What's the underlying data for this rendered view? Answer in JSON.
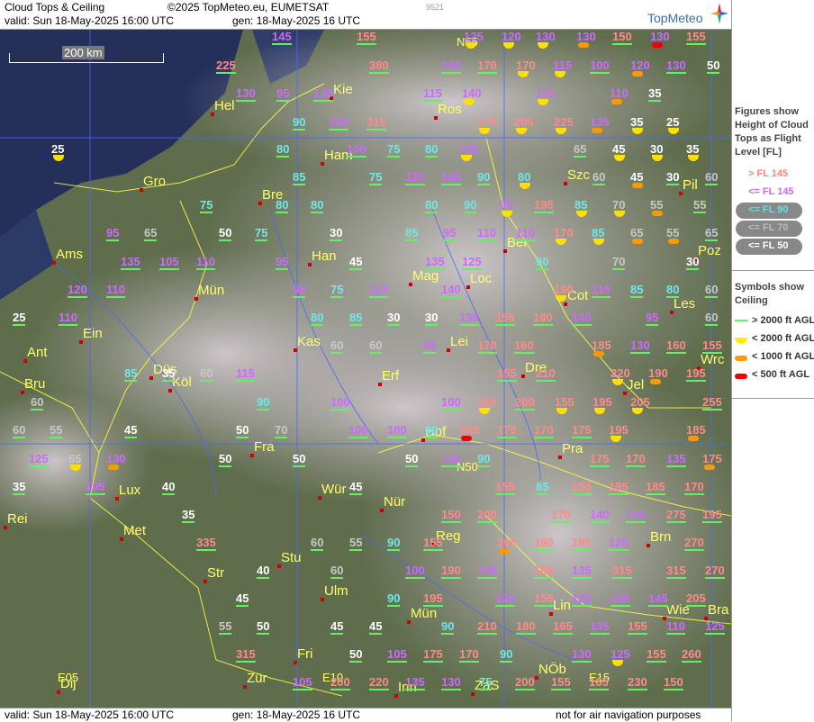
{
  "header": {
    "title": "Cloud Tops & Ceiling",
    "copyright": "©2025 TopMeteo.eu, EUMETSAT",
    "id": "9521",
    "valid": "valid:  Sun  18-May-2025  16:00 UTC",
    "generated": "gen: 18-May-2025 16 UTC",
    "logo": "TopMeteo"
  },
  "footer": {
    "valid": "valid:  Sun  18-May-2025  16:00 UTC",
    "generated": "gen: 18-May-2025 16 UTC",
    "note": "not for air navigation purposes"
  },
  "scale": "200 km",
  "legend": {
    "figures_title": "Figures show Height of Cloud Tops as Flight Level  [FL]",
    "fl_items": [
      {
        "label": "> FL 145",
        "color": "#ff8080"
      },
      {
        "label": "<= FL 145",
        "color": "#cc66ff"
      },
      {
        "label": "<= FL 90",
        "color": "#66e0e0"
      },
      {
        "label": "<= FL 70",
        "color": "#bbbbbb"
      },
      {
        "label": "<= FL 50",
        "color": "#ffffff"
      }
    ],
    "symbols_title": "Symbols show Ceiling",
    "ceil_items": [
      {
        "label": "> 2000 ft AGL",
        "color": "#66ee66"
      },
      {
        "label": "< 2000 ft AGL",
        "color": "#ffee00"
      },
      {
        "label": "< 1000 ft AGL",
        "color": "#ff9900"
      },
      {
        "label": "< 500 ft AGL",
        "color": "#ee0000"
      }
    ]
  },
  "cities": [
    "Hel",
    "Kie",
    "Ham",
    "Gro",
    "Bre",
    "Ams",
    "Han",
    "Ber",
    "Mag",
    "Loc",
    "Szc",
    "Pil",
    "Poz",
    "Cot",
    "Les",
    "Ein",
    "Mün",
    "Kas",
    "Lei",
    "Dre",
    "Wrc",
    "Ant",
    "Düs",
    "Köl",
    "Bru",
    "Erf",
    "Jel",
    "Hof",
    "Pra",
    "Fra",
    "Lux",
    "Wür",
    "Nür",
    "Reg",
    "Brn",
    "Met",
    "Stu",
    "Str",
    "Ulm",
    "Mün",
    "Lin",
    "Wie",
    "Bra",
    "Fri",
    "Zür",
    "Inn",
    "ZaS",
    "NÖb",
    "Rei",
    "Dij",
    "Ros"
  ],
  "labels": [
    "N55",
    "N50",
    "E10",
    "E15",
    "E05"
  ],
  "values": [
    [
      "145",
      "N"
    ],
    [
      "155",
      "N"
    ],
    [
      "130",
      "A"
    ],
    [
      "150",
      "N"
    ],
    [
      "130",
      "R"
    ],
    [
      "155",
      "N"
    ],
    [
      "120",
      "Y"
    ],
    [
      "130",
      "Y"
    ],
    [
      "125",
      "Y"
    ],
    [
      "225",
      "N"
    ],
    [
      "380",
      "N"
    ],
    [
      "140",
      "N"
    ],
    [
      "170",
      "N"
    ],
    [
      "170",
      "Y"
    ],
    [
      "115",
      "Y"
    ],
    [
      "100",
      "N"
    ],
    [
      "120",
      "A"
    ],
    [
      "130",
      "N"
    ],
    [
      "50",
      "N"
    ],
    [
      "130",
      "N"
    ],
    [
      "95",
      "N"
    ],
    [
      "130",
      "N"
    ],
    [
      "115",
      "N"
    ],
    [
      "140",
      "Y"
    ],
    [
      "115",
      "Y"
    ],
    [
      "110",
      "A"
    ],
    [
      "35",
      "N"
    ],
    [
      "90",
      "N"
    ],
    [
      "100",
      "N"
    ],
    [
      "315",
      "N"
    ],
    [
      "175",
      "Y"
    ],
    [
      "205",
      "Y"
    ],
    [
      "225",
      "Y"
    ],
    [
      "135",
      "A"
    ],
    [
      "35",
      "Y"
    ],
    [
      "25",
      "Y"
    ],
    [
      "25",
      "Y"
    ],
    [
      "80",
      "N"
    ],
    [
      "100",
      "N"
    ],
    [
      "75",
      "N"
    ],
    [
      "80",
      "N"
    ],
    [
      "130",
      "Y"
    ],
    [
      "65",
      "N"
    ],
    [
      "45",
      "Y"
    ],
    [
      "30",
      "Y"
    ],
    [
      "35",
      "Y"
    ],
    [
      "85",
      "N"
    ],
    [
      "75",
      "N"
    ],
    [
      "120",
      "N"
    ],
    [
      "145",
      "N"
    ],
    [
      "90",
      "N"
    ],
    [
      "80",
      "Y"
    ],
    [
      "60",
      "N"
    ],
    [
      "45",
      "A"
    ],
    [
      "30",
      "N"
    ],
    [
      "60",
      "N"
    ],
    [
      "75",
      "N"
    ],
    [
      "80",
      "N"
    ],
    [
      "80",
      "N"
    ],
    [
      "80",
      "N"
    ],
    [
      "90",
      "N"
    ],
    [
      "95",
      "Y"
    ],
    [
      "195",
      "N"
    ],
    [
      "85",
      "Y"
    ],
    [
      "70",
      "Y"
    ],
    [
      "55",
      "A"
    ],
    [
      "55",
      "N"
    ],
    [
      "95",
      "N"
    ],
    [
      "65",
      "N"
    ],
    [
      "50",
      "N"
    ],
    [
      "75",
      "N"
    ],
    [
      "30",
      "N"
    ],
    [
      "85",
      "N"
    ],
    [
      "95",
      "N"
    ],
    [
      "110",
      "N"
    ],
    [
      "110",
      "N"
    ],
    [
      "170",
      "Y"
    ],
    [
      "85",
      "Y"
    ],
    [
      "65",
      "A"
    ],
    [
      "55",
      "A"
    ],
    [
      "65",
      "N"
    ],
    [
      "135",
      "N"
    ],
    [
      "105",
      "N"
    ],
    [
      "110",
      "N"
    ],
    [
      "95",
      "N"
    ],
    [
      "45",
      "N"
    ],
    [
      "135",
      "N"
    ],
    [
      "125",
      "N"
    ],
    [
      "90",
      "N"
    ],
    [
      "70",
      "N"
    ],
    [
      "30",
      "N"
    ],
    [
      "120",
      "N"
    ],
    [
      "110",
      "N"
    ],
    [
      "75",
      "N"
    ],
    [
      "115",
      "N"
    ],
    [
      "95",
      "N"
    ],
    [
      "140",
      "N"
    ],
    [
      "190",
      "Y"
    ],
    [
      "115",
      "N"
    ],
    [
      "85",
      "N"
    ],
    [
      "80",
      "N"
    ],
    [
      "60",
      "N"
    ],
    [
      "25",
      "N"
    ],
    [
      "110",
      "N"
    ],
    [
      "80",
      "N"
    ],
    [
      "85",
      "N"
    ],
    [
      "30",
      "N"
    ],
    [
      "30",
      "N"
    ],
    [
      "135",
      "N"
    ],
    [
      "155",
      "N"
    ],
    [
      "190",
      "N"
    ],
    [
      "140",
      "N"
    ],
    [
      "95",
      "N"
    ],
    [
      "60",
      "N"
    ],
    [
      "60",
      "N"
    ],
    [
      "60",
      "N"
    ],
    [
      "95",
      "N"
    ],
    [
      "170",
      "N"
    ],
    [
      "160",
      "N"
    ],
    [
      "185",
      "A"
    ],
    [
      "130",
      "N"
    ],
    [
      "160",
      "N"
    ],
    [
      "155",
      "N"
    ],
    [
      "85",
      "N"
    ],
    [
      "35",
      "N"
    ],
    [
      "60",
      "N"
    ],
    [
      "115",
      "N"
    ],
    [
      "155",
      "N"
    ],
    [
      "210",
      "N"
    ],
    [
      "220",
      "Y"
    ],
    [
      "190",
      "A"
    ],
    [
      "195",
      "N"
    ],
    [
      "60",
      "N"
    ],
    [
      "90",
      "N"
    ],
    [
      "100",
      "N"
    ],
    [
      "100",
      "N"
    ],
    [
      "160",
      "Y"
    ],
    [
      "200",
      "N"
    ],
    [
      "155",
      "Y"
    ],
    [
      "195",
      "Y"
    ],
    [
      "205",
      "Y"
    ],
    [
      "255",
      "N"
    ],
    [
      "60",
      "N"
    ],
    [
      "55",
      "N"
    ],
    [
      "45",
      "N"
    ],
    [
      "50",
      "N"
    ],
    [
      "70",
      "N"
    ],
    [
      "100",
      "N"
    ],
    [
      "100",
      "N"
    ],
    [
      "90",
      "N"
    ],
    [
      "205",
      "R"
    ],
    [
      "175",
      "N"
    ],
    [
      "170",
      "N"
    ],
    [
      "175",
      "N"
    ],
    [
      "195",
      "Y"
    ],
    [
      "185",
      "A"
    ],
    [
      "125",
      "N"
    ],
    [
      "65",
      "Y"
    ],
    [
      "130",
      "A"
    ],
    [
      "50",
      "N"
    ],
    [
      "50",
      "N"
    ],
    [
      "50",
      "N"
    ],
    [
      "130",
      "N"
    ],
    [
      "90",
      "N"
    ],
    [
      "175",
      "N"
    ],
    [
      "170",
      "N"
    ],
    [
      "135",
      "N"
    ],
    [
      "175",
      "A"
    ],
    [
      "35",
      "N"
    ],
    [
      "105",
      "N"
    ],
    [
      "40",
      "N"
    ],
    [
      "45",
      "N"
    ],
    [
      "155",
      "N"
    ],
    [
      "85",
      "N"
    ],
    [
      "155",
      "N"
    ],
    [
      "195",
      "N"
    ],
    [
      "185",
      "N"
    ],
    [
      "170",
      "N"
    ],
    [
      "35",
      "N"
    ],
    [
      "150",
      "N"
    ],
    [
      "200",
      "N"
    ],
    [
      "170",
      "N"
    ],
    [
      "140",
      "N"
    ],
    [
      "135",
      "N"
    ],
    [
      "275",
      "N"
    ],
    [
      "195",
      "N"
    ],
    [
      "335",
      "N"
    ],
    [
      "60",
      "N"
    ],
    [
      "55",
      "N"
    ],
    [
      "90",
      "N"
    ],
    [
      "155",
      "N"
    ],
    [
      "205",
      "A"
    ],
    [
      "190",
      "N"
    ],
    [
      "195",
      "N"
    ],
    [
      "120",
      "N"
    ],
    [
      "270",
      "N"
    ],
    [
      "40",
      "N"
    ],
    [
      "60",
      "N"
    ],
    [
      "100",
      "N"
    ],
    [
      "190",
      "N"
    ],
    [
      "145",
      "N"
    ],
    [
      "185",
      "N"
    ],
    [
      "135",
      "N"
    ],
    [
      "315",
      "N"
    ],
    [
      "315",
      "N"
    ],
    [
      "270",
      "N"
    ],
    [
      "45",
      "N"
    ],
    [
      "90",
      "N"
    ],
    [
      "195",
      "N"
    ],
    [
      "120",
      "N"
    ],
    [
      "155",
      "N"
    ],
    [
      "120",
      "N"
    ],
    [
      "135",
      "N"
    ],
    [
      "145",
      "N"
    ],
    [
      "205",
      "N"
    ],
    [
      "55",
      "N"
    ],
    [
      "50",
      "N"
    ],
    [
      "45",
      "N"
    ],
    [
      "45",
      "N"
    ],
    [
      "90",
      "N"
    ],
    [
      "210",
      "N"
    ],
    [
      "180",
      "N"
    ],
    [
      "165",
      "N"
    ],
    [
      "135",
      "N"
    ],
    [
      "155",
      "N"
    ],
    [
      "110",
      "N"
    ],
    [
      "125",
      "N"
    ],
    [
      "315",
      "N"
    ],
    [
      "50",
      "N"
    ],
    [
      "105",
      "N"
    ],
    [
      "175",
      "N"
    ],
    [
      "170",
      "N"
    ],
    [
      "90",
      "N"
    ],
    [
      "130",
      "N"
    ],
    [
      "125",
      "Y"
    ],
    [
      "155",
      "N"
    ],
    [
      "260",
      "N"
    ],
    [
      "105",
      "N"
    ],
    [
      "200",
      "N"
    ],
    [
      "220",
      "N"
    ],
    [
      "135",
      "N"
    ],
    [
      "130",
      "N"
    ],
    [
      "75",
      "N"
    ],
    [
      "200",
      "N"
    ],
    [
      "155",
      "N"
    ],
    [
      "165",
      "N"
    ],
    [
      "230",
      "N"
    ],
    [
      "150",
      "N"
    ]
  ]
}
